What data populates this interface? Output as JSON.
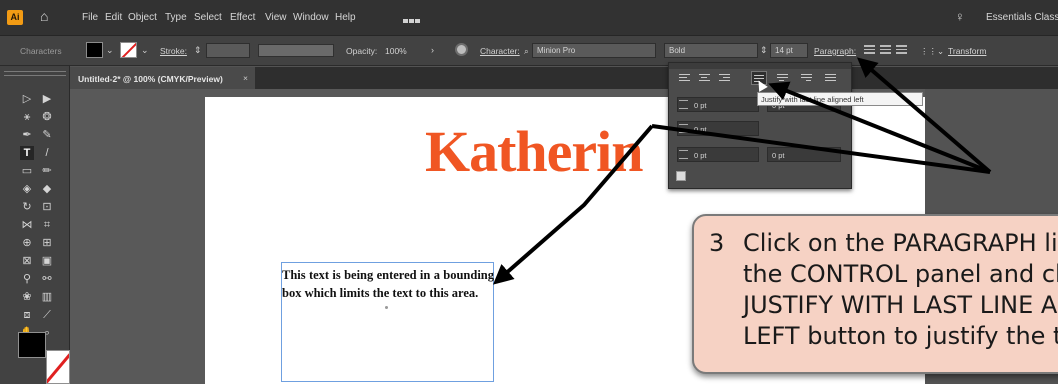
{
  "menubar": {
    "logo": "Ai",
    "items": [
      "File",
      "Edit",
      "Object",
      "Type",
      "Select",
      "Effect",
      "View",
      "Window",
      "Help"
    ],
    "workspace": "Essentials Classic"
  },
  "control": {
    "mode": "Characters",
    "stroke_label": "Stroke:",
    "opacity_label": "Opacity:",
    "opacity_value": "100%",
    "character_label": "Character:",
    "font": "Minion Pro",
    "style": "Bold",
    "size": "14 pt",
    "paragraph_label": "Paragraph:",
    "transform_label": "Transform"
  },
  "document": {
    "tab_title": "Untitled-2* @ 100% (CMYK/Preview)",
    "tab_close": "×"
  },
  "artboard": {
    "headline": "Katherin",
    "body_text": "This text is being entered in a bounding box which limits the text to this area."
  },
  "paragraph_panel": {
    "indent_left": "0 pt",
    "indent_right": "0 pt",
    "first_line": "0 pt",
    "space_before": "0 pt",
    "space_after": "0 pt",
    "tooltip": "Justify with last line aligned left"
  },
  "callout": {
    "number": "3",
    "lines": [
      "Click on the PARAGRAPH link in",
      "the CONTROL panel and click the",
      "JUSTIFY WITH LAST LINE ALIGNED",
      "LEFT button to justify the text."
    ]
  },
  "colors": {
    "headline": "#f05623",
    "callout_fill": "#f6d2c4",
    "ui_dark": "#323232",
    "arrow": "#000000"
  },
  "icons": [
    "home-icon",
    "lightbulb-icon",
    "selection-tool-icon",
    "type-tool-icon",
    "hand-tool-icon",
    "zoom-tool-icon",
    "justify-last-left-icon"
  ]
}
